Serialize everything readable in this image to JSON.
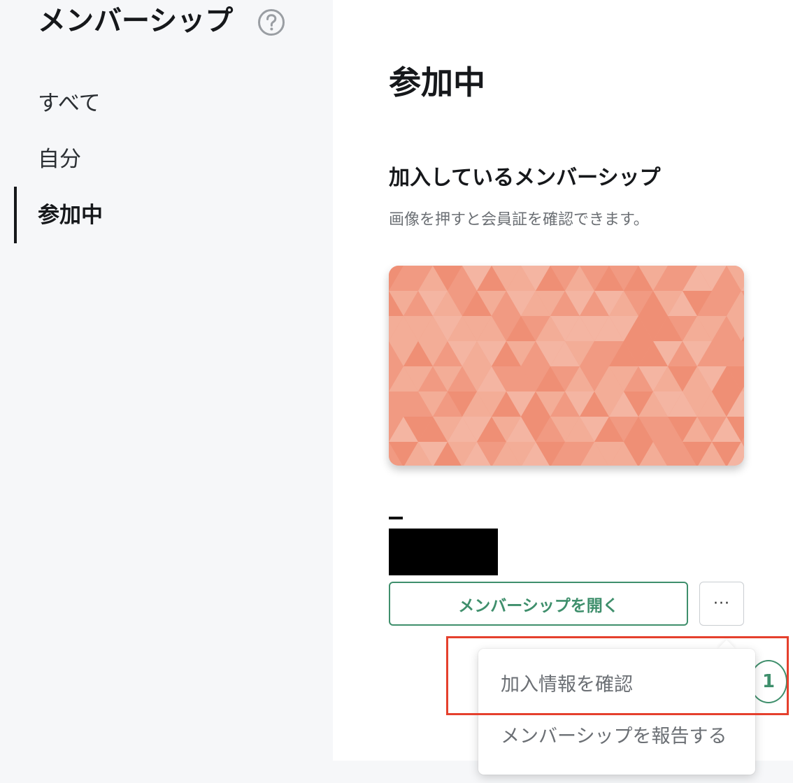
{
  "sidebar": {
    "title": "メンバーシップ",
    "help_icon": "question-circle-icon",
    "items": [
      {
        "label": "すべて",
        "active": false
      },
      {
        "label": "自分",
        "active": false
      },
      {
        "label": "参加中",
        "active": true
      }
    ]
  },
  "main": {
    "page_title": "参加中",
    "section_title": "加入しているメンバーシップ",
    "section_description": "画像を押すと会員証を確認できます。",
    "card": {
      "pattern_colors": [
        "#f19a82",
        "#f3ad97",
        "#ef8f75",
        "#f4b5a2"
      ]
    },
    "open_button_label": "メンバーシップを開く",
    "more_button_label": "···",
    "more_button_icon": "ellipsis-icon"
  },
  "dropdown": {
    "items": [
      {
        "label": "加入情報を確認"
      },
      {
        "label": "メンバーシップを報告する"
      }
    ]
  },
  "annotation": {
    "step_number": "1",
    "highlight_color": "#e5402d"
  },
  "colors": {
    "accent": "#3f8f6c",
    "sidebar_bg": "#f6f7f9",
    "main_bg": "#ffffff"
  }
}
